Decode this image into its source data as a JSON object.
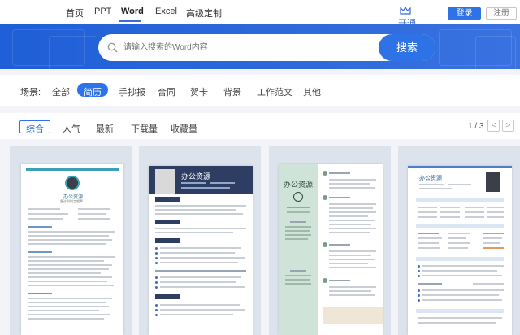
{
  "nav": {
    "items": [
      {
        "label": "首页"
      },
      {
        "label": "PPT"
      },
      {
        "label": "Word"
      },
      {
        "label": "Excel"
      },
      {
        "label": "高级定制"
      }
    ],
    "active_index": 2,
    "vip_label": "开通VIP",
    "login_label": "登录",
    "register_label": "注册"
  },
  "search": {
    "placeholder": "请输入搜索的Word内容",
    "button_label": "搜索"
  },
  "scene": {
    "label": "场景:",
    "items": [
      "全部",
      "简历",
      "手抄报",
      "合同",
      "贺卡",
      "背景",
      "工作范文",
      "其他"
    ],
    "active_index": 1
  },
  "sort": {
    "items": [
      "综合",
      "人气",
      "最新",
      "下载量",
      "收藏量"
    ],
    "active_index": 0,
    "page_info": "1 / 3",
    "prev_icon": "chevron-left-icon",
    "next_icon": "chevron-right-icon"
  },
  "templates": [
    {
      "name": "办公资源",
      "subtitle": "急诊科科工程师"
    },
    {
      "name": "办公资源"
    },
    {
      "name": "办公资源"
    },
    {
      "name": "办公资源"
    }
  ],
  "colors": {
    "accent": "#2d72e6",
    "hero": "#2a67d9",
    "card1_accent": "#3da0b8",
    "card2_header": "#2e3e63",
    "card3_side": "#cfe3d8",
    "card4_header": "#4a7fc6"
  }
}
